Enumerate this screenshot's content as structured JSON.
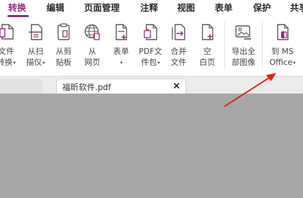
{
  "menu": {
    "tabs": [
      {
        "label": "转换",
        "active": true
      },
      {
        "label": "编辑"
      },
      {
        "label": "页面管理"
      },
      {
        "label": "注释"
      },
      {
        "label": "视图"
      },
      {
        "label": "表单"
      },
      {
        "label": "保护"
      },
      {
        "label": "共享"
      }
    ]
  },
  "ribbon": {
    "buttons": [
      {
        "line1": "文件",
        "line2": "转换",
        "icon": "file-convert-icon"
      },
      {
        "line1": "从扫",
        "line2": "描仪",
        "icon": "scanner-icon"
      },
      {
        "line1": "从剪",
        "line2": "贴板",
        "icon": "clipboard-icon"
      },
      {
        "line1": "从",
        "line2": "网页",
        "icon": "globe-icon"
      },
      {
        "line1": "表单",
        "line2": "",
        "icon": "form-icon"
      },
      {
        "line1": "PDF文",
        "line2": "件包",
        "icon": "pdf-package-icon"
      },
      {
        "line1": "合并",
        "line2": "文件",
        "icon": "merge-files-icon"
      },
      {
        "line1": "空",
        "line2": "白页",
        "icon": "blank-page-icon"
      },
      {
        "line1": "导出全",
        "line2": "部图像",
        "icon": "export-images-icon"
      },
      {
        "line1": "到 MS",
        "line2": "Office",
        "icon": "to-office-icon"
      }
    ],
    "dropdown_glyph": "▾"
  },
  "document_tabs": {
    "active_tab": "福昕软件.pdf",
    "close_glyph": "×"
  },
  "colors": {
    "accent": "#8e2a7a",
    "workspace": "#a7a7a7",
    "annotation_arrow": "#e0201b"
  }
}
